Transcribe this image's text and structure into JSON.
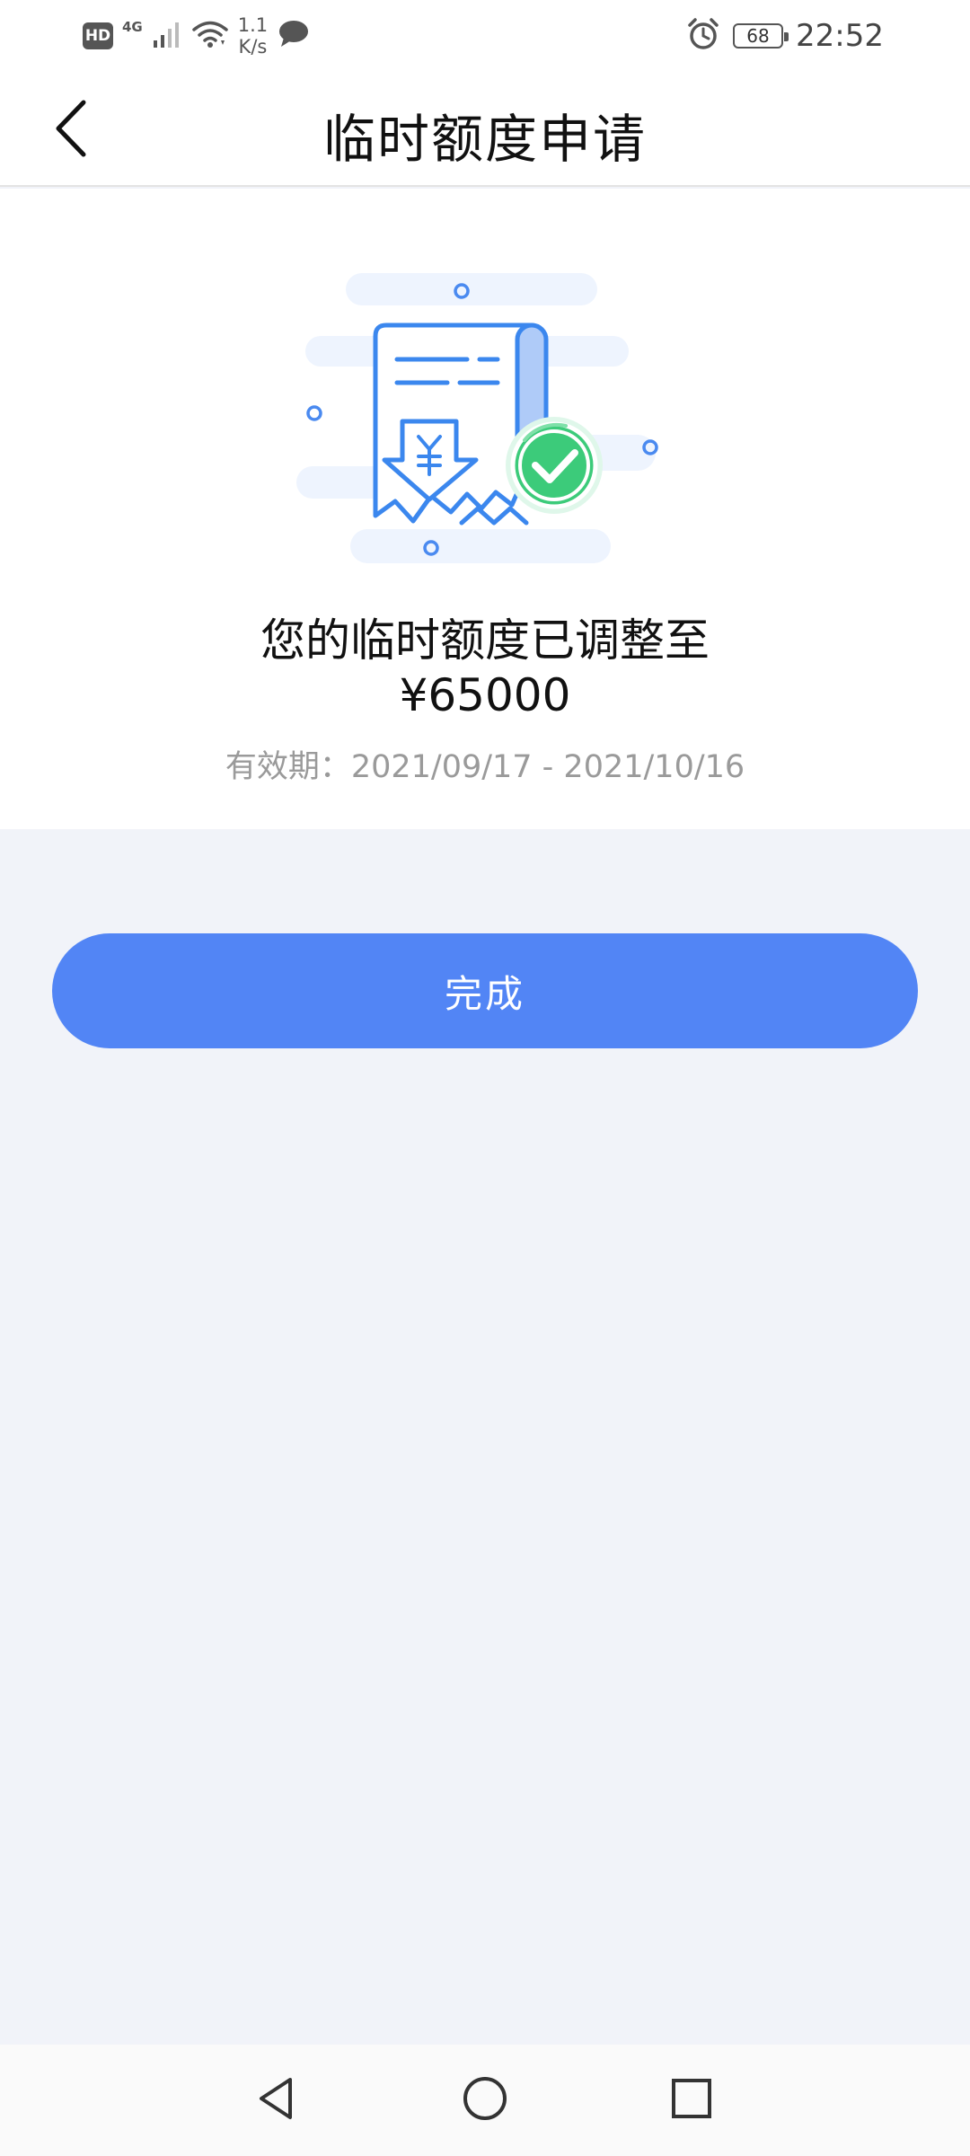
{
  "status_bar": {
    "hd": "HD",
    "network_type": "4G",
    "speed_value": "1.1",
    "speed_unit": "K/s",
    "battery_level": "68",
    "time": "22:52",
    "icons": [
      "hd-icon",
      "signal-icon",
      "wifi-icon",
      "chat-icon",
      "alarm-icon",
      "battery-icon"
    ]
  },
  "header": {
    "title": "临时额度申请",
    "back_icon": "chevron-left-icon"
  },
  "result": {
    "illustration": "receipt-success-icon",
    "title": "您的临时额度已调整至",
    "amount": "¥65000",
    "validity": "有效期：2021/09/17 - 2021/10/16"
  },
  "actions": {
    "done_label": "完成"
  },
  "nav_bar": {
    "icons": [
      "back-triangle-icon",
      "home-circle-icon",
      "recents-square-icon"
    ]
  },
  "colors": {
    "accent": "#5285F5",
    "success": "#3CCB7A",
    "page_bg": "#F1F3F9",
    "card_bg": "#FFFFFF",
    "muted_text": "#9A9A9A"
  }
}
